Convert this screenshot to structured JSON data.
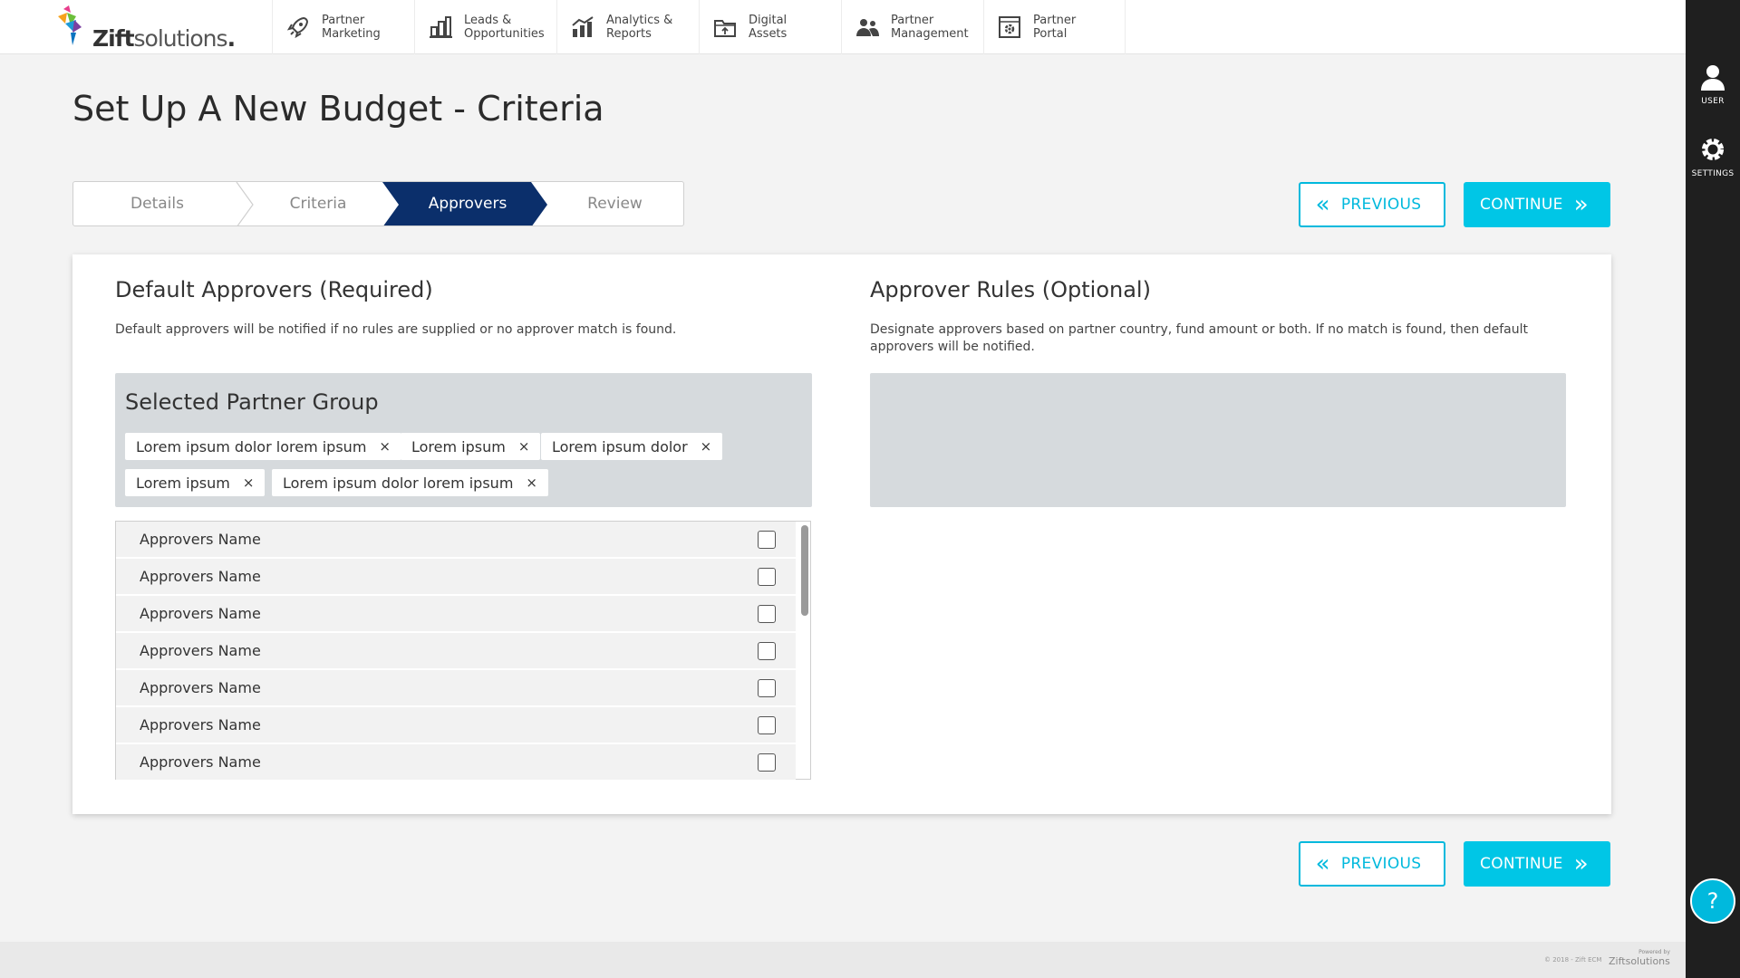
{
  "brand": {
    "logo_bold": "Zift",
    "logo_light": "solutions",
    "logo_dot": "."
  },
  "nav": [
    {
      "label": "Partner Marketing",
      "icon": "rocket-icon"
    },
    {
      "label": "Leads & Opportunities",
      "icon": "building-chart-icon"
    },
    {
      "label": "Analytics & Reports",
      "icon": "analytics-chart-icon"
    },
    {
      "label": "Digital Assets",
      "icon": "folder-upload-icon"
    },
    {
      "label": "Partner Management",
      "icon": "people-icon"
    },
    {
      "label": "Partner Portal",
      "icon": "portal-gear-icon"
    }
  ],
  "rail": {
    "user_label": "USER",
    "settings_label": "SETTINGS",
    "help_label": "?"
  },
  "page": {
    "title": "Set Up A New Budget - Criteria"
  },
  "stepper": {
    "steps": [
      "Details",
      "Criteria",
      "Approvers",
      "Review"
    ],
    "active": "Approvers"
  },
  "buttons": {
    "previous": "PREVIOUS",
    "continue": "CONTINUE"
  },
  "colors": {
    "accent": "#00c6e6",
    "stepper_active": "#0b2f6b",
    "panel": "#d6dadd"
  },
  "default_approvers": {
    "title": "Default Approvers (Required)",
    "description": "Default approvers will be notified if no rules are supplied or no approver match is found.",
    "group_title": "Selected Partner Group",
    "tags": [
      "Lorem ipsum dolor lorem ipsum",
      "Lorem ipsum",
      "Lorem ipsum dolor",
      "Lorem ipsum",
      "Lorem ipsum dolor lorem ipsum"
    ],
    "tag_remove": "×",
    "approvers": [
      "Approvers Name",
      "Approvers Name",
      "Approvers Name",
      "Approvers Name",
      "Approvers Name",
      "Approvers Name",
      "Approvers Name"
    ]
  },
  "approver_rules": {
    "title": "Approver Rules (Optional)",
    "description": "Designate approvers based on partner country, fund amount or both. If no match is found, then default approvers will be notified."
  },
  "footer": {
    "copyright": "© 2018 - Zift ECM",
    "powered_by": "Powered by",
    "powered_brand": "Ziftsolutions"
  }
}
